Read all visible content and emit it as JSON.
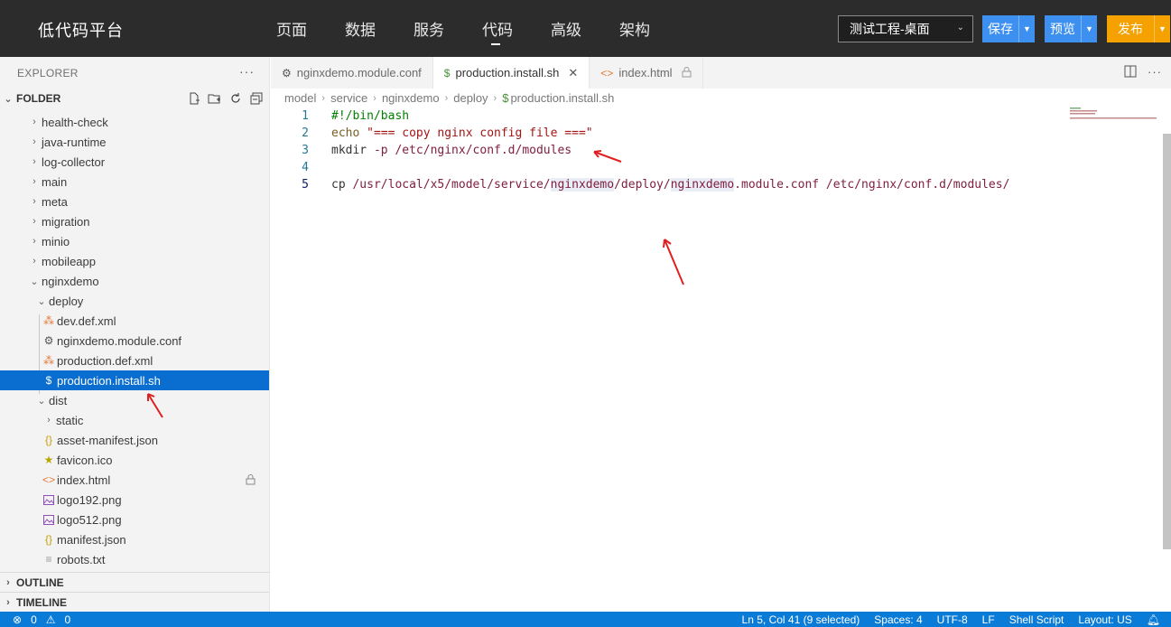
{
  "app": {
    "title": "低代码平台",
    "nav": [
      "页面",
      "数据",
      "服务",
      "代码",
      "高级",
      "架构"
    ],
    "project": "测试工程-桌面",
    "save_label": "保存",
    "preview_label": "预览",
    "publish_label": "发布"
  },
  "sidebar": {
    "explorer_title": "EXPLORER",
    "folder_title": "FOLDER",
    "tree": [
      {
        "label": "health-check",
        "type": "folder",
        "state": "collapsed"
      },
      {
        "label": "java-runtime",
        "type": "folder",
        "state": "collapsed"
      },
      {
        "label": "log-collector",
        "type": "folder",
        "state": "collapsed"
      },
      {
        "label": "main",
        "type": "folder",
        "state": "collapsed"
      },
      {
        "label": "meta",
        "type": "folder",
        "state": "collapsed"
      },
      {
        "label": "migration",
        "type": "folder",
        "state": "collapsed"
      },
      {
        "label": "minio",
        "type": "folder",
        "state": "collapsed"
      },
      {
        "label": "mobileapp",
        "type": "folder",
        "state": "collapsed"
      },
      {
        "label": "nginxdemo",
        "type": "folder",
        "state": "expanded"
      },
      {
        "label": "deploy",
        "type": "folder",
        "state": "expanded"
      },
      {
        "label": "dev.def.xml",
        "type": "file",
        "icon": "rss-icon"
      },
      {
        "label": "nginxdemo.module.conf",
        "type": "file",
        "icon": "gear-icon"
      },
      {
        "label": "production.def.xml",
        "type": "file",
        "icon": "rss-icon"
      },
      {
        "label": "production.install.sh",
        "type": "file",
        "icon": "dollar-icon"
      },
      {
        "label": "dist",
        "type": "folder",
        "state": "expanded"
      },
      {
        "label": "static",
        "type": "folder",
        "state": "collapsed"
      },
      {
        "label": "asset-manifest.json",
        "type": "file",
        "icon": "braces-icon"
      },
      {
        "label": "favicon.ico",
        "type": "file",
        "icon": "star-icon"
      },
      {
        "label": "index.html",
        "type": "file",
        "icon": "code-icon"
      },
      {
        "label": "logo192.png",
        "type": "file",
        "icon": "image-icon"
      },
      {
        "label": "logo512.png",
        "type": "file",
        "icon": "image-icon"
      },
      {
        "label": "manifest.json",
        "type": "file",
        "icon": "braces-icon"
      },
      {
        "label": "robots.txt",
        "type": "file",
        "icon": "lines-icon"
      }
    ],
    "outline_label": "OUTLINE",
    "timeline_label": "TIMELINE"
  },
  "editor": {
    "tabs": [
      {
        "label": "nginxdemo.module.conf",
        "icon": "gear-icon"
      },
      {
        "label": "production.install.sh",
        "icon": "dollar-icon",
        "active": true
      },
      {
        "label": "index.html",
        "icon": "code-icon",
        "locked": true
      }
    ],
    "breadcrumb": [
      "model",
      "service",
      "nginxdemo",
      "deploy",
      "production.install.sh"
    ],
    "lines": [
      {
        "n": "1",
        "tokens": [
          {
            "t": "#!/bin/bash",
            "c": "comment"
          }
        ]
      },
      {
        "n": "2",
        "tokens": [
          {
            "t": "echo ",
            "c": "kw"
          },
          {
            "t": "\"=== copy nginx config file ===\"",
            "c": "str"
          }
        ]
      },
      {
        "n": "3",
        "tokens": [
          {
            "t": "mkdir ",
            "c": "plain"
          },
          {
            "t": "-p /etc/nginx/conf.d/modules",
            "c": "path"
          }
        ]
      },
      {
        "n": "4",
        "tokens": []
      },
      {
        "n": "5",
        "tokens": [
          {
            "t": "cp ",
            "c": "plain"
          },
          {
            "t": "/usr/local/x5/model/service/",
            "c": "path"
          },
          {
            "t": "nginxdemo",
            "c": "path",
            "hl": true
          },
          {
            "t": "/deploy/",
            "c": "path"
          },
          {
            "t": "nginxdemo",
            "c": "path",
            "hl": true
          },
          {
            "t": ".module.conf /etc/nginx/conf.d/modules/",
            "c": "path"
          }
        ]
      }
    ]
  },
  "status": {
    "errors": "0",
    "warnings": "0",
    "position": "Ln 5, Col 41 (9 selected)",
    "spaces": "Spaces: 4",
    "encoding": "UTF-8",
    "eol": "LF",
    "language": "Shell Script",
    "layout": "Layout: US"
  },
  "colors": {
    "topbar": "#2c2c2c",
    "primary_button": "#3e90f0",
    "publish_button": "#f5a200",
    "selection": "#0a6ed1",
    "statusbar": "#0a7bd7"
  }
}
